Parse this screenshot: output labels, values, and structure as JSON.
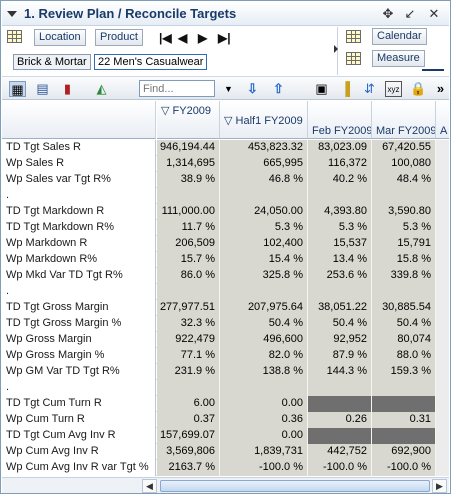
{
  "window": {
    "title": "1. Review Plan / Reconcile Targets",
    "icons": [
      "move-icon",
      "minimize-icon",
      "close-icon"
    ]
  },
  "dimensions": {
    "location_label": "Location",
    "product_label": "Product",
    "calendar_label": "Calendar",
    "measure_label": "Measure"
  },
  "filters": {
    "location_value": "Brick & Mortar",
    "product_value": "22 Men's Casualwear"
  },
  "toolbar": {
    "find_placeholder": "Find..."
  },
  "grid": {
    "corner_header": "",
    "columns": [
      {
        "label": "FY2009",
        "prefix": "▽"
      },
      {
        "label": "Half1 FY2009",
        "prefix": "▽"
      },
      {
        "label": "Feb FY2009",
        "prefix": ""
      },
      {
        "label": "Mar FY2009",
        "prefix": ""
      },
      {
        "label": "A",
        "prefix": ""
      }
    ],
    "rows": [
      {
        "label": "TD Tgt Sales R",
        "values": [
          "946,194.44",
          "453,823.32",
          "83,023.09",
          "67,420.55"
        ],
        "style": [
          "",
          "",
          "",
          ""
        ]
      },
      {
        "label": "Wp Sales R",
        "values": [
          "1,314,695",
          "665,995",
          "116,372",
          "100,080"
        ],
        "style": [
          "",
          "",
          "",
          ""
        ]
      },
      {
        "label": "Wp Sales var Tgt R%",
        "values": [
          "38.9 %",
          "46.8 %",
          "40.2 %",
          "48.4 %"
        ],
        "style": [
          "",
          "",
          "",
          ""
        ]
      },
      {
        "label": ".",
        "values": [
          "",
          "",
          "",
          ""
        ],
        "style": [
          "",
          "",
          "",
          ""
        ]
      },
      {
        "label": "TD Tgt Markdown R",
        "values": [
          "111,000.00",
          "24,050.00",
          "4,393.80",
          "3,590.80"
        ],
        "style": [
          "",
          "",
          "",
          ""
        ]
      },
      {
        "label": "TD Tgt Markdown R%",
        "values": [
          "11.7 %",
          "5.3 %",
          "5.3 %",
          "5.3 %"
        ],
        "style": [
          "",
          "",
          "",
          ""
        ]
      },
      {
        "label": "Wp Markdown R",
        "values": [
          "206,509",
          "102,400",
          "15,537",
          "15,791"
        ],
        "style": [
          "",
          "",
          "",
          ""
        ]
      },
      {
        "label": "Wp Markdown R%",
        "values": [
          "15.7 %",
          "15.4 %",
          "13.4 %",
          "15.8 %"
        ],
        "style": [
          "",
          "",
          "",
          ""
        ]
      },
      {
        "label": "Wp Mkd Var TD Tgt R%",
        "values": [
          "86.0 %",
          "325.8 %",
          "253.6 %",
          "339.8 %"
        ],
        "style": [
          "",
          "",
          "",
          ""
        ]
      },
      {
        "label": ".",
        "values": [
          "",
          "",
          "",
          ""
        ],
        "style": [
          "",
          "",
          "",
          ""
        ]
      },
      {
        "label": "TD Tgt Gross Margin",
        "values": [
          "277,977.51",
          "207,975.64",
          "38,051.22",
          "30,885.54"
        ],
        "style": [
          "",
          "",
          "",
          ""
        ]
      },
      {
        "label": "TD Tgt Gross Margin %",
        "values": [
          "32.3 %",
          "50.4 %",
          "50.4 %",
          "50.4 %"
        ],
        "style": [
          "",
          "",
          "",
          ""
        ]
      },
      {
        "label": "Wp Gross Margin",
        "values": [
          "922,479",
          "496,600",
          "92,952",
          "80,074"
        ],
        "style": [
          "",
          "",
          "",
          ""
        ]
      },
      {
        "label": "Wp Gross Margin %",
        "values": [
          "77.1 %",
          "82.0 %",
          "87.9 %",
          "88.0 %"
        ],
        "style": [
          "",
          "",
          "",
          ""
        ]
      },
      {
        "label": "Wp GM Var TD Tgt R%",
        "values": [
          "231.9 %",
          "138.8 %",
          "144.3 %",
          "159.3 %"
        ],
        "style": [
          "",
          "",
          "",
          ""
        ]
      },
      {
        "label": ".",
        "values": [
          "",
          "",
          "",
          ""
        ],
        "style": [
          "",
          "",
          "",
          ""
        ]
      },
      {
        "label": "TD Tgt Cum Turn R",
        "values": [
          "6.00",
          "0.00",
          "",
          ""
        ],
        "style": [
          "",
          "",
          "dark",
          "dark"
        ]
      },
      {
        "label": "Wp Cum Turn R",
        "values": [
          "0.37",
          "0.36",
          "0.26",
          "0.31"
        ],
        "style": [
          "",
          "",
          "",
          ""
        ]
      },
      {
        "label": "TD Tgt Cum Avg Inv R",
        "values": [
          "157,699.07",
          "0.00",
          "",
          ""
        ],
        "style": [
          "",
          "",
          "dark",
          "dark"
        ]
      },
      {
        "label": "Wp Cum Avg Inv R",
        "values": [
          "3,569,806",
          "1,839,731",
          "442,752",
          "692,900"
        ],
        "style": [
          "",
          "",
          "",
          ""
        ]
      },
      {
        "label": "Wp Cum Avg Inv R var Tgt %",
        "values": [
          "2163.7 %",
          "-100.0 %",
          "-100.0 %",
          "-100.0 %"
        ],
        "style": [
          "",
          "",
          "",
          ""
        ]
      }
    ]
  },
  "colors": {
    "cell_bg": "#d8d8d0",
    "protected_cell_bg": "#6f6f6f",
    "header_text": "#1a3a6a"
  }
}
